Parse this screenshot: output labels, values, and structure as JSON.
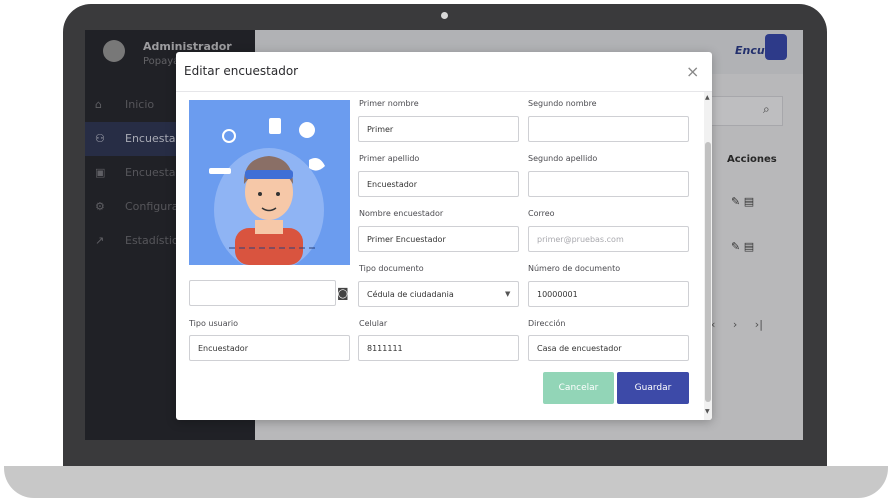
{
  "sidebar": {
    "user_name": "Administrador",
    "user_city": "Popayán",
    "items": [
      {
        "label": "Inicio",
        "icon": "home-icon"
      },
      {
        "label": "Encuestadores",
        "icon": "users-icon",
        "active": true
      },
      {
        "label": "Encuestas",
        "icon": "survey-icon"
      },
      {
        "label": "Configuración",
        "icon": "gear-icon"
      },
      {
        "label": "Estadísticas",
        "icon": "chart-icon"
      }
    ]
  },
  "main": {
    "logo": "Encuest",
    "table_header_actions": "Acciones",
    "pager": "‹ › ›|"
  },
  "modal": {
    "title": "Editar encuestador",
    "close": "×",
    "photo_name": "",
    "fields": {
      "primer_nombre": {
        "label": "Primer nombre",
        "value": "Primer",
        "placeholder": ""
      },
      "segundo_nombre": {
        "label": "Segundo nombre",
        "value": "",
        "placeholder": ""
      },
      "primer_apellido": {
        "label": "Primer apellido",
        "value": "Encuestador",
        "placeholder": ""
      },
      "segundo_apellido": {
        "label": "Segundo apellido",
        "value": "",
        "placeholder": ""
      },
      "nombre_encuestador": {
        "label": "Nombre encuestador",
        "value": "Primer Encuestador",
        "placeholder": ""
      },
      "correo": {
        "label": "Correo",
        "value": "",
        "placeholder": "primer@pruebas.com"
      },
      "tipo_documento": {
        "label": "Tipo documento",
        "value": "Cédula de ciudadania"
      },
      "numero_documento": {
        "label": "Número de documento",
        "value": "10000001",
        "placeholder": ""
      },
      "tipo_usuario": {
        "label": "Tipo usuario",
        "value": "Encuestador",
        "placeholder": ""
      },
      "celular": {
        "label": "Celular",
        "value": "8111111",
        "placeholder": ""
      },
      "direccion": {
        "label": "Dirección",
        "value": "Casa de encuestador",
        "placeholder": ""
      }
    },
    "buttons": {
      "cancel": "Cancelar",
      "save": "Guardar"
    }
  },
  "colors": {
    "sidebar_bg": "#2a2b31",
    "accent": "#3d4aa8",
    "cancel": "#92d5b7",
    "photo_bg": "#6b9cef"
  }
}
